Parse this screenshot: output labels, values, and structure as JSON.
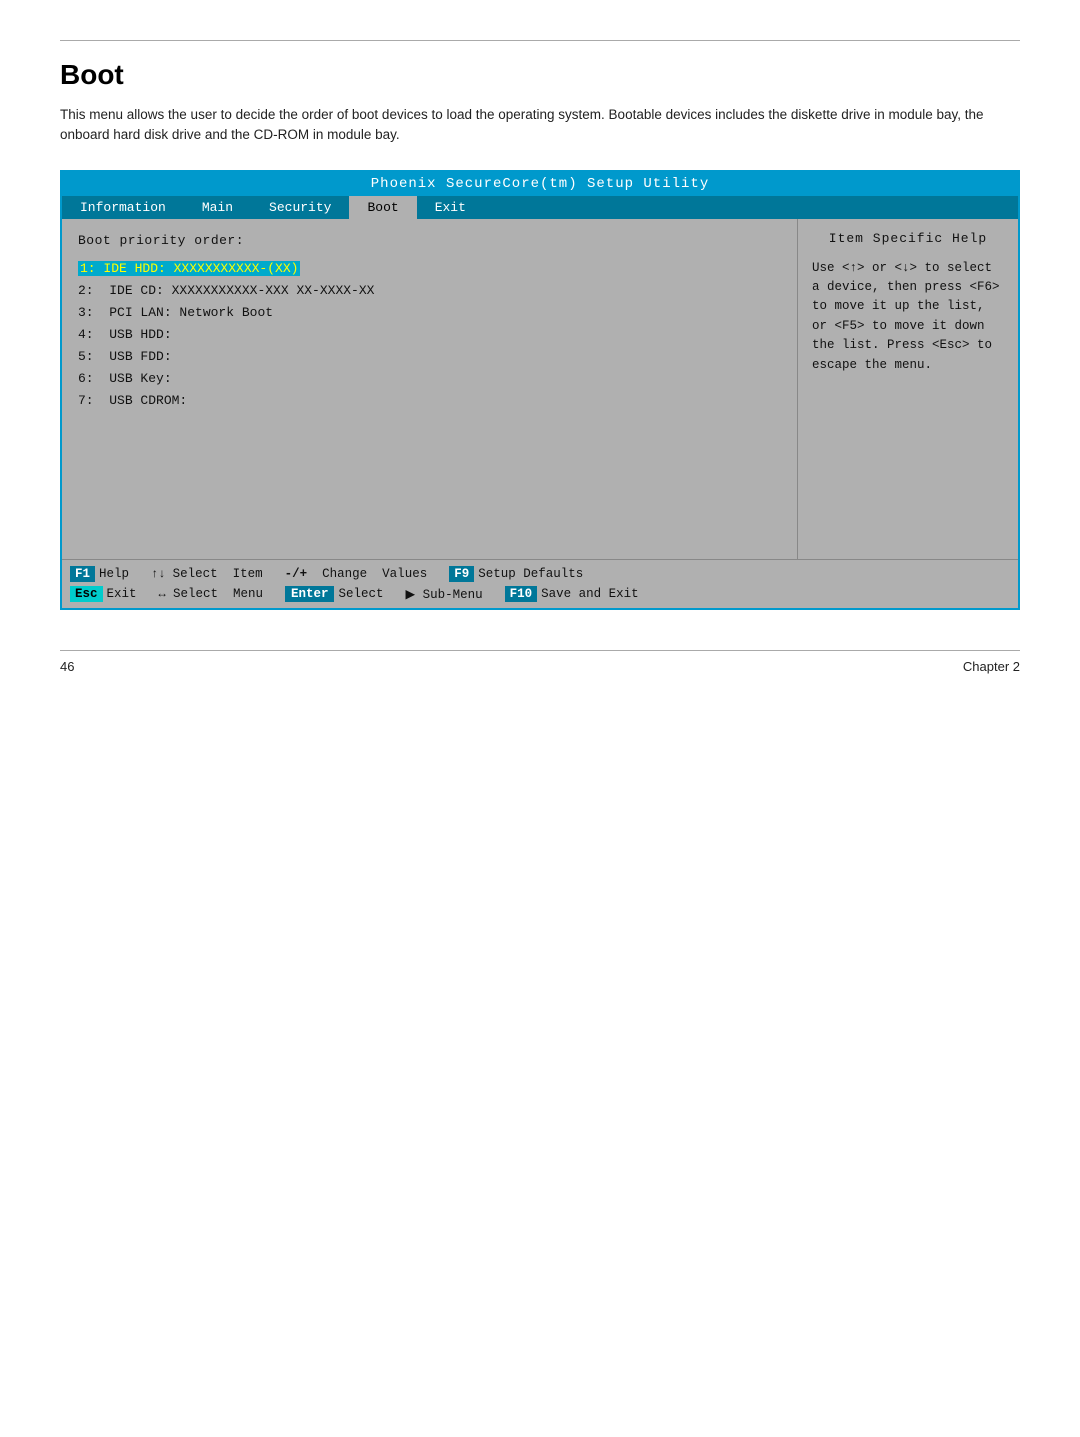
{
  "page": {
    "title": "Boot",
    "description": "This menu allows the user to decide the order of boot devices to load the operating system. Bootable devices includes the diskette drive in module bay, the onboard hard disk drive and the CD-ROM in module bay.",
    "footer_left": "46",
    "footer_right": "Chapter 2"
  },
  "bios": {
    "title_bar": "Phoenix SecureCore(tm)  Setup  Utility",
    "nav_items": [
      {
        "label": "Information",
        "active": false
      },
      {
        "label": "Main",
        "active": false
      },
      {
        "label": "Security",
        "active": false
      },
      {
        "label": "Boot",
        "active": true
      },
      {
        "label": "Exit",
        "active": false
      }
    ],
    "section_label": "Boot priority order:",
    "boot_items": [
      {
        "index": "1:",
        "device": "IDE HDD: XXXXXXXXXXX-(XX)",
        "highlighted": true
      },
      {
        "index": "2:",
        "device": "IDE CD: XXXXXXXXXXX-XXX  XX-XXXX-XX",
        "highlighted": false
      },
      {
        "index": "3:",
        "device": "PCI LAN: Network Boot",
        "highlighted": false
      },
      {
        "index": "4:",
        "device": "USB HDD:",
        "highlighted": false
      },
      {
        "index": "5:",
        "device": "USB FDD:",
        "highlighted": false
      },
      {
        "index": "6:",
        "device": "USB Key:",
        "highlighted": false
      },
      {
        "index": "7:",
        "device": "USB CDROM:",
        "highlighted": false
      }
    ],
    "help_title": "Item Specific Help",
    "help_text": "Use <↑> or <↓> to select a device, then press <F6> to move it up the list, or <F5> to move it down the list. Press <Esc> to escape the menu.",
    "footer": {
      "row1": [
        {
          "key": "F1",
          "key_type": "blue",
          "label": "Help"
        },
        {
          "key": "↑↓",
          "key_type": "icon",
          "label": "Select  Item"
        },
        {
          "key": "-/+",
          "key_type": "plain",
          "label": "Change  Values"
        },
        {
          "key": "F9",
          "key_type": "blue",
          "label": "Setup Defaults"
        }
      ],
      "row2": [
        {
          "key": "Esc",
          "key_type": "cyan",
          "label": "Exit"
        },
        {
          "key": "↔",
          "key_type": "icon",
          "label": "Select  Menu"
        },
        {
          "key": "Enter",
          "key_type": "blue",
          "label": "Select"
        },
        {
          "key": "▶ Sub-Menu",
          "key_type": "plain_label",
          "label": ""
        },
        {
          "key": "F10",
          "key_type": "blue",
          "label": "Save  and  Exit"
        }
      ]
    }
  }
}
